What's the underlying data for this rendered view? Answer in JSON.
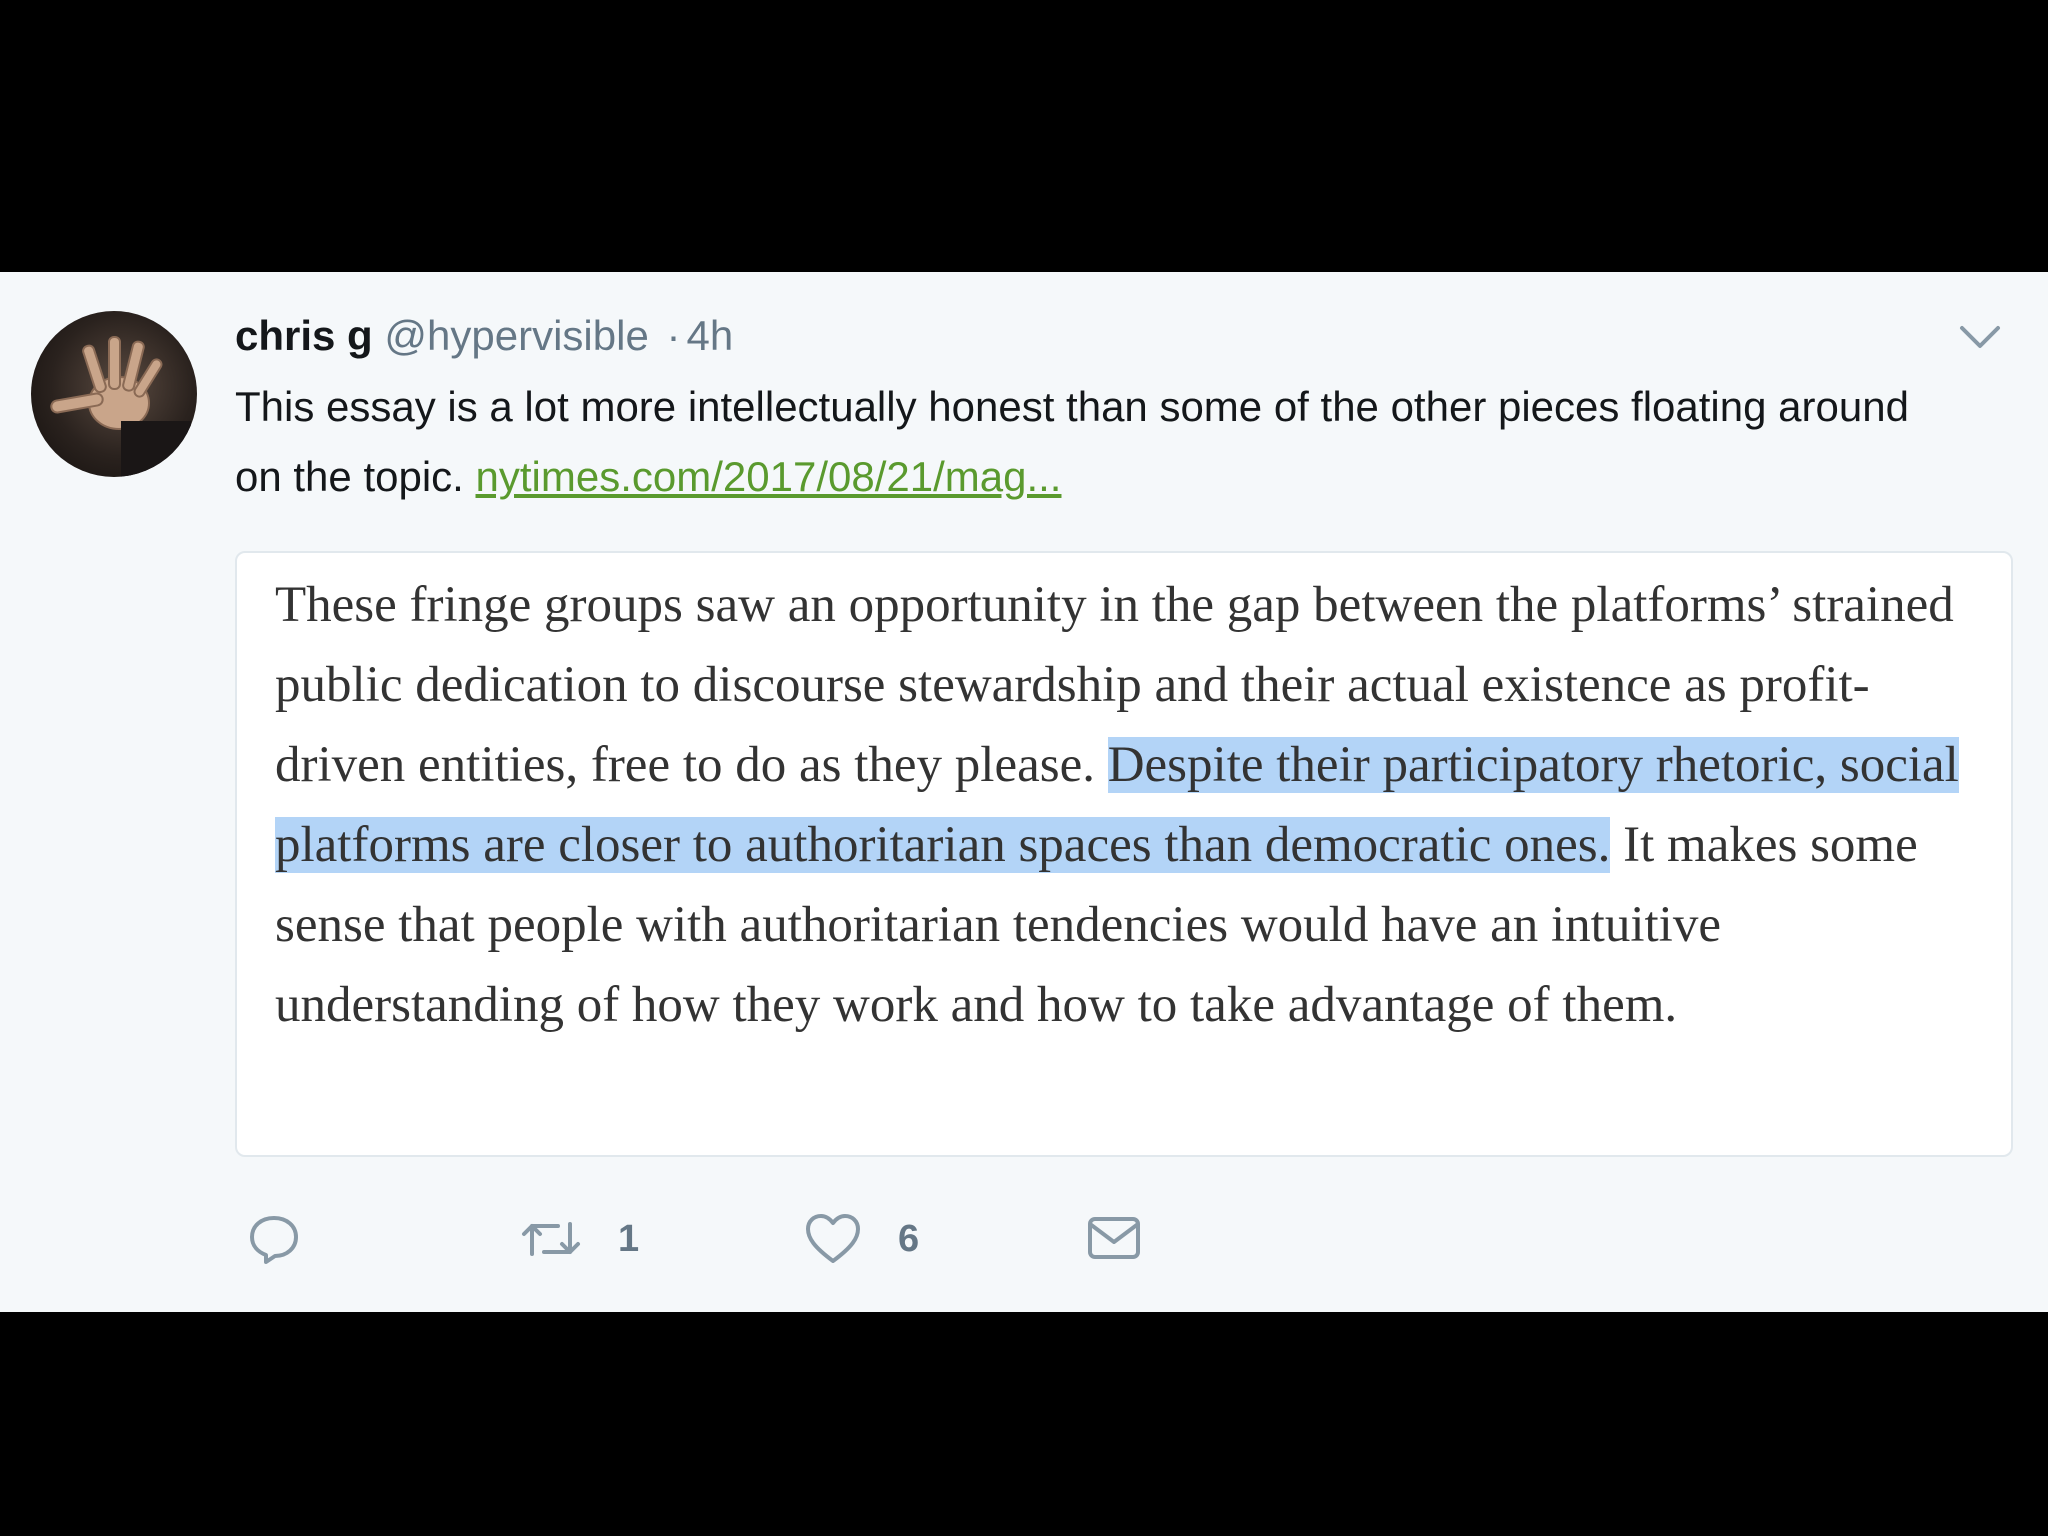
{
  "tweet": {
    "author_name": "chris g",
    "handle": "@hypervisible",
    "separator": "·",
    "time": "4h",
    "text": "This essay is a lot more intellectually honest than some of the other pieces floating around on the topic.",
    "link_text": "nytimes.com/2017/08/21/mag..."
  },
  "quote": {
    "before": "These fringe groups saw an opportunity in the gap between the platforms’ strained public dedication to discourse stewardship and their actual existence as profit-driven entities, free to do as they please. ",
    "highlighted": "Despite their participatory rhetoric, social platforms are closer to authoritarian spaces than democratic ones.",
    "after": " It makes some sense that people with authoritarian tendencies would have an intuitive understanding of how they work and how to take advantage of them."
  },
  "actions": {
    "reply": {
      "icon": "reply-icon"
    },
    "retweet": {
      "icon": "retweet-icon",
      "count": "1"
    },
    "like": {
      "icon": "heart-icon",
      "count": "6"
    },
    "message": {
      "icon": "envelope-icon"
    }
  },
  "colors": {
    "link": "#5a9a2e",
    "highlight": "#b3d4f7",
    "background": "#f5f8fa"
  }
}
